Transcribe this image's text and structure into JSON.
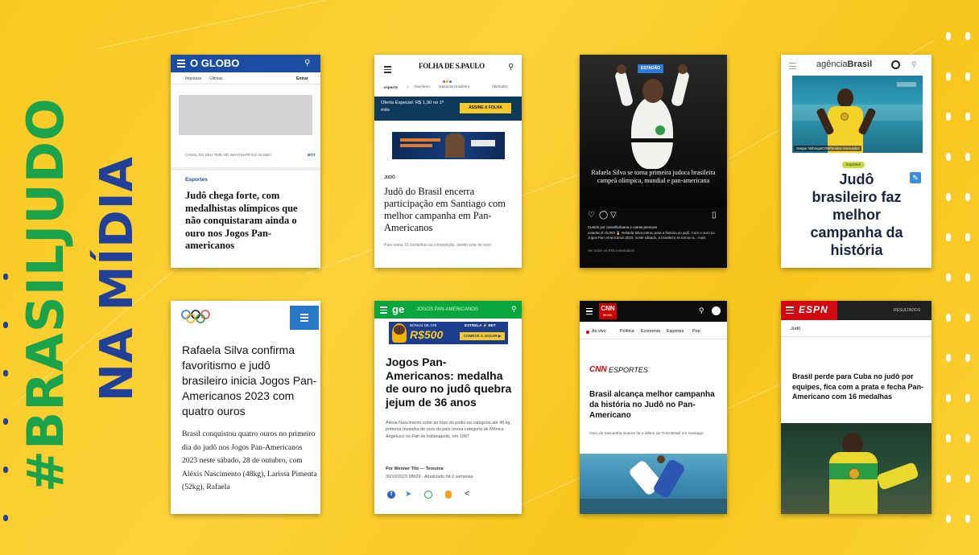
{
  "slide": {
    "hashtag": "#BRASILJUDO",
    "subtitle": "NA MÍDIA",
    "colors": {
      "background": "#f9c920",
      "green": "#1aa34a",
      "blue": "#21409a",
      "white": "#ffffff"
    }
  },
  "cards": {
    "oglobo": {
      "logo": "O GLOBO",
      "nav": [
        "Impresso",
        "Últimas"
      ],
      "login": "Entrar",
      "banner": "CANAL DO SEU TIME NO WHATSAPP DO GLOBO",
      "banner_more": "BOT",
      "section": "Esportes",
      "headline": "Judô chega forte, com medalhistas olímpicos que não conquistaram ainda o ouro nos Jogos Pan-americanos",
      "icons": [
        "menu-icon",
        "search-icon"
      ]
    },
    "folha": {
      "logo": "FOLHA DE S.PAULO",
      "crumbs": [
        "esporte",
        ">",
        "brasileiro",
        "tabela do brasileiro",
        "libertador"
      ],
      "offer": "Oferta Especial: R$ 1,90 no 1º mês",
      "offer_button": "ASSINE A FOLHA",
      "section": "JUDÔ",
      "headline": "Judô do Brasil encerra participação em Santiago com melhor campanha em Pan-Americanos",
      "lead": "País soma 16 medalhas na competição, sendo sete de ouro",
      "icons": [
        "menu-icon",
        "search-icon"
      ]
    },
    "estadao": {
      "badge": "ESTADÃO",
      "caption": "Rafaela Silva se torna primeira judoca brasileira campeã olímpica, mundial e pan-americana",
      "likes": "Curtido por carvalhoiluana e outras pessoas",
      "text": "estadao É OURO 🥇 Rafaela Silva entrou para a história do judô. Com o ouro no Jogos Pan-Americanos 2023, neste sábado, a brasileira se tornou a... mais",
      "comments": "Ver todos os 879 comentários",
      "icons": [
        "heart-icon",
        "comment-icon",
        "share-icon",
        "bookmark-icon"
      ]
    },
    "agencia": {
      "logo_prefix": "agência",
      "logo": "Brasil",
      "photo_credit": "Gaspar Nóbrega/COB/Direitos reservados",
      "tag": "Esportes",
      "headline": "Judô brasileiro faz melhor campanha da história",
      "icons": [
        "menu-icon",
        "search-icon",
        "translate-icon"
      ]
    },
    "cob": {
      "headline": "Rafaela Silva confirma favoritismo e judô brasileiro inicia Jogos Pan-Americanos 2023 com quatro ouros",
      "body": "Brasil conquistou quatro ouros no primeiro dia do judô nos Jogos Pan-Americanos 2023 neste sábado, 28 de outubro, com Aléxis Nascimento (48kg), Larissa Pimenta (52kg), Rafaela",
      "icons": [
        "olympic-rings-icon",
        "menu-icon"
      ]
    },
    "ge": {
      "logo": "ge",
      "section": "JOGOS PAN-AMERICANOS",
      "ad_top": "BÔNUS DE ATÉ",
      "ad_value": "R$500",
      "ad_brand": "ESTRELA ⚡ BET",
      "ad_button": "COMECE A JOGAR ▶",
      "headline": "Jogos Pan-Americanos: medalha de ouro no judô quebra jejum de 36 anos",
      "lead": "Aléxia Nascimento sobe ao topo do pódio na categoria até 48 kg, primeira medalha de ouro do país nessa categoria de Mônica Angelucci no Pan de Indianápolis, em 1987",
      "byline": "Por Wenner Tito — Teresina",
      "date": "30/10/2023 08h29 · Atualizado há 2 semanas",
      "icons": [
        "menu-icon",
        "search-icon",
        "facebook-icon",
        "twitter-icon",
        "whatsapp-icon",
        "share-icon"
      ]
    },
    "cnn": {
      "logo": "CNN",
      "logo_sub": "BRASIL",
      "live": "Ao vivo",
      "nav": [
        "Política",
        "Economia",
        "Esportes",
        "Pop"
      ],
      "section_logo": "CNN",
      "section": "ESPORTES",
      "headline": "Brasil alcança melhor campanha da história no Judô no Pan-Americano",
      "lead": "Ouro de Samantha Soares foi o último do Time Brasil em Santiago",
      "icons": [
        "menu-icon",
        "search-icon"
      ]
    },
    "espn": {
      "logo": "ESPN",
      "results": "RESULTADOS",
      "section": "Judô",
      "headline": "Brasil perde para Cuba no judô por equipes, fica com a prata e fecha Pan-Americano com 16 medalhas",
      "icons": [
        "menu-icon"
      ]
    }
  }
}
